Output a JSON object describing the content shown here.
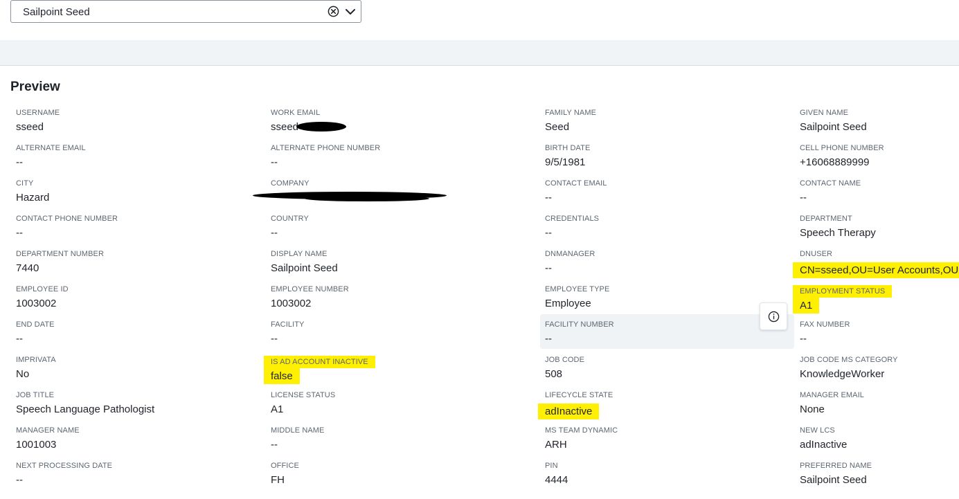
{
  "selector": {
    "value": "Sailpoint Seed"
  },
  "preview": {
    "title": "Preview",
    "fields": [
      {
        "label": "USERNAME",
        "value": "sseed"
      },
      {
        "label": "WORK EMAIL",
        "value": "sseed"
      },
      {
        "label": "FAMILY NAME",
        "value": "Seed"
      },
      {
        "label": "GIVEN NAME",
        "value": "Sailpoint Seed"
      },
      {
        "label": "ALTERNATE EMAIL",
        "value": "--"
      },
      {
        "label": "ALTERNATE PHONE NUMBER",
        "value": "--"
      },
      {
        "label": "BIRTH DATE",
        "value": "9/5/1981"
      },
      {
        "label": "CELL PHONE NUMBER",
        "value": "+16068889999"
      },
      {
        "label": "CITY",
        "value": "Hazard"
      },
      {
        "label": "COMPANY",
        "value": ""
      },
      {
        "label": "CONTACT EMAIL",
        "value": "--"
      },
      {
        "label": "CONTACT NAME",
        "value": "--"
      },
      {
        "label": "CONTACT PHONE NUMBER",
        "value": "--"
      },
      {
        "label": "COUNTRY",
        "value": "--"
      },
      {
        "label": "CREDENTIALS",
        "value": "--"
      },
      {
        "label": "DEPARTMENT",
        "value": "Speech Therapy"
      },
      {
        "label": "DEPARTMENT NUMBER",
        "value": "7440"
      },
      {
        "label": "DISPLAY NAME",
        "value": "Sailpoint Seed"
      },
      {
        "label": "DNMANAGER",
        "value": "--"
      },
      {
        "label": "DNUSER",
        "value": "CN=sseed,OU=User Accounts,OU=S"
      },
      {
        "label": "EMPLOYEE ID",
        "value": "1003002"
      },
      {
        "label": "EMPLOYEE NUMBER",
        "value": "1003002"
      },
      {
        "label": "EMPLOYEE TYPE",
        "value": "Employee"
      },
      {
        "label": "EMPLOYMENT STATUS",
        "value": "A1"
      },
      {
        "label": "END DATE",
        "value": "--"
      },
      {
        "label": "FACILITY",
        "value": "--"
      },
      {
        "label": "FACILITY NUMBER",
        "value": "--"
      },
      {
        "label": "FAX NUMBER",
        "value": "--"
      },
      {
        "label": "IMPRIVATA",
        "value": "No"
      },
      {
        "label": "IS AD ACCOUNT INACTIVE",
        "value": "false"
      },
      {
        "label": "JOB CODE",
        "value": "508"
      },
      {
        "label": "JOB CODE MS CATEGORY",
        "value": "KnowledgeWorker"
      },
      {
        "label": "JOB TITLE",
        "value": "Speech Language Pathologist"
      },
      {
        "label": "LICENSE STATUS",
        "value": "A1"
      },
      {
        "label": "LIFECYCLE STATE",
        "value": "adInactive"
      },
      {
        "label": "MANAGER EMAIL",
        "value": "None"
      },
      {
        "label": "MANAGER NAME",
        "value": "1001003"
      },
      {
        "label": "MIDDLE NAME",
        "value": "--"
      },
      {
        "label": "MS TEAM DYNAMIC",
        "value": "ARH"
      },
      {
        "label": "NEW LCS",
        "value": "adInactive"
      },
      {
        "label": "NEXT PROCESSING DATE",
        "value": "--"
      },
      {
        "label": "OFFICE",
        "value": "FH"
      },
      {
        "label": "PIN",
        "value": "4444"
      },
      {
        "label": "PREFERRED NAME",
        "value": "Sailpoint Seed"
      }
    ]
  },
  "colors": {
    "highlight": "#ffef00",
    "label": "#5d6670",
    "text": "#1f2329",
    "band": "#f1f4f7"
  },
  "icons": {
    "clear": "clear-circle-x-icon",
    "dropdown": "chevron-down-icon",
    "info": "info-icon"
  }
}
